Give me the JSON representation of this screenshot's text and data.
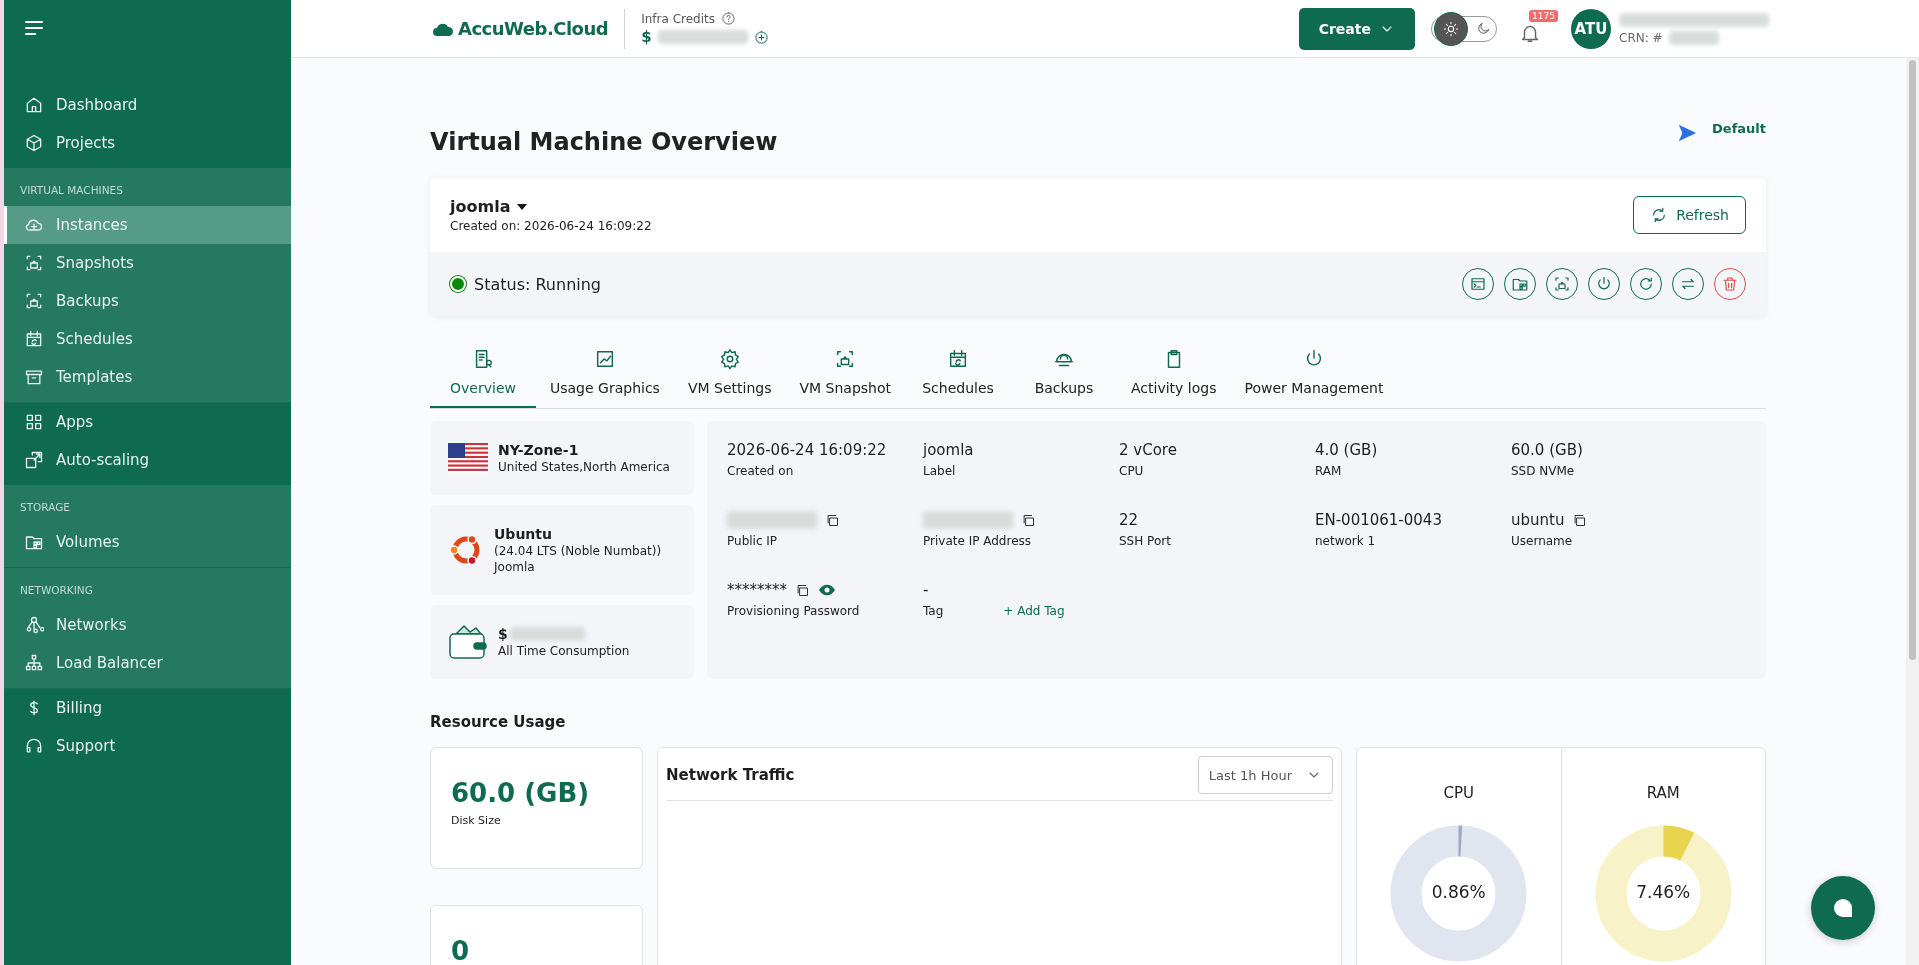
{
  "sidebar": {
    "sections": [
      {
        "items": [
          {
            "label": "Dashboard",
            "selected": false
          },
          {
            "label": "Projects",
            "selected": false
          }
        ]
      },
      {
        "heading": "VIRTUAL MACHINES",
        "items": [
          {
            "label": "Instances",
            "selected": true
          },
          {
            "label": "Snapshots",
            "selected": false
          },
          {
            "label": "Backups",
            "selected": false
          },
          {
            "label": "Schedules",
            "selected": false
          },
          {
            "label": "Templates",
            "selected": false
          }
        ]
      },
      {
        "items": [
          {
            "label": "Apps",
            "selected": false
          },
          {
            "label": "Auto-scaling",
            "selected": false
          }
        ]
      },
      {
        "heading": "STORAGE",
        "items": [
          {
            "label": "Volumes",
            "selected": false
          }
        ]
      },
      {
        "heading": "NETWORKING",
        "items": [
          {
            "label": "Networks",
            "selected": false
          },
          {
            "label": "Load Balancer",
            "selected": false
          }
        ]
      },
      {
        "items": [
          {
            "label": "Billing",
            "selected": false
          },
          {
            "label": "Support",
            "selected": false
          }
        ]
      }
    ]
  },
  "topbar": {
    "logo": "AccuWeb.Cloud",
    "credits_label": "Infra Credits",
    "credits_currency": "$",
    "create_button": "Create",
    "dark_mode": false,
    "notification_count": "1175",
    "avatar": "ATU",
    "crn_label": "CRN: #"
  },
  "page": {
    "title": "Virtual Machine Overview",
    "view": "Default"
  },
  "instance": {
    "name": "joomla",
    "created": "Created on: 2026-06-24 16:09:22",
    "refresh_button": "Refresh",
    "status": "Status: Running",
    "running": true,
    "actions": [
      {
        "kind": "normal"
      },
      {
        "kind": "normal"
      },
      {
        "kind": "normal"
      },
      {
        "kind": "normal"
      },
      {
        "kind": "normal"
      },
      {
        "kind": "normal"
      },
      {
        "kind": "danger"
      }
    ]
  },
  "tabs": [
    {
      "label": "Overview",
      "selected": true
    },
    {
      "label": "Usage Graphics",
      "selected": false
    },
    {
      "label": "VM Settings",
      "selected": false
    },
    {
      "label": "VM Snapshot",
      "selected": false
    },
    {
      "label": "Schedules",
      "selected": false
    },
    {
      "label": "Backups",
      "selected": false
    },
    {
      "label": "Activity logs",
      "selected": false
    },
    {
      "label": "Power Management",
      "selected": false
    }
  ],
  "location": {
    "zone": "NY-Zone-1",
    "region": "United States,North America"
  },
  "os": {
    "name": "Ubuntu",
    "version": "(24.04 LTS (Noble Numbat))",
    "app": "Joomla"
  },
  "consumption": {
    "currency": "$",
    "label": "All Time Consumption"
  },
  "details": [
    {
      "kind": "plain",
      "value": "2026-06-24 16:09:22",
      "label": "Created on"
    },
    {
      "kind": "plain",
      "value": "joomla",
      "label": "Label"
    },
    {
      "kind": "plain",
      "value": "2 vCore",
      "label": "CPU"
    },
    {
      "kind": "plain",
      "value": "4.0 (GB)",
      "label": "RAM"
    },
    {
      "kind": "plain",
      "value": "60.0 (GB)",
      "label": "SSD NVMe"
    },
    {
      "kind": "redacted",
      "label": "Public IP"
    },
    {
      "kind": "redacted",
      "label": "Private IP Address"
    },
    {
      "kind": "plain",
      "value": "22",
      "label": "SSH Port"
    },
    {
      "kind": "plain",
      "value": "EN-001061-0043",
      "label": "network 1"
    },
    {
      "kind": "copy",
      "value": "ubuntu",
      "label": "Username"
    },
    {
      "kind": "secret",
      "value": "********",
      "label": "Provisioning Password"
    },
    {
      "kind": "tag",
      "value": "-",
      "label": "Tag",
      "link": "+ Add Tag"
    }
  ],
  "resources": {
    "heading": "Resource Usage",
    "stats": [
      {
        "value": "60.0 (GB)",
        "label": "Disk Size"
      },
      {
        "value": "0"
      }
    ],
    "network": {
      "title": "Network Traffic",
      "range": "Last 1h Hour"
    },
    "gauges": [
      {
        "title": "CPU",
        "reading": "0.86%",
        "level": 0.0086,
        "color": "#9aa9c9"
      },
      {
        "title": "RAM",
        "reading": "7.46%",
        "level": 0.0746,
        "color": "#e8d44d"
      }
    ]
  }
}
